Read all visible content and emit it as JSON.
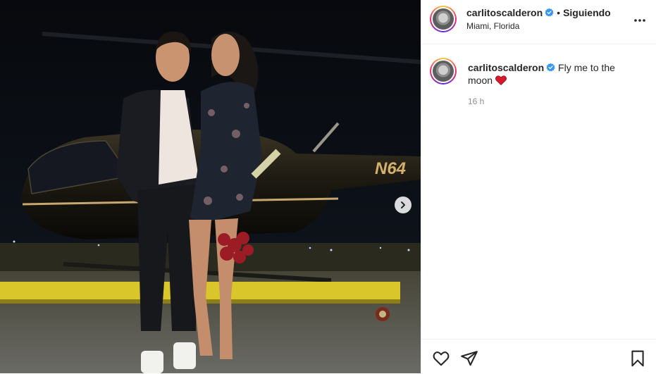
{
  "post": {
    "username": "carlitoscalderon",
    "follow_status": "Siguiendo",
    "location": "Miami, Florida",
    "caption_text": "Fly me to the moon",
    "caption_emoji": "heart",
    "time_ago": "16 h"
  },
  "photo": {
    "tail_number": "N64"
  },
  "icons": {
    "verified": "verified-badge-icon",
    "more": "more-options-icon",
    "like": "heart-icon",
    "share": "paper-plane-icon",
    "save": "bookmark-icon",
    "next": "chevron-right-icon"
  },
  "colors": {
    "verified_blue": "#3897f0",
    "heart_red": "#ed4956",
    "text": "#262626",
    "muted": "#8e8e8e"
  }
}
